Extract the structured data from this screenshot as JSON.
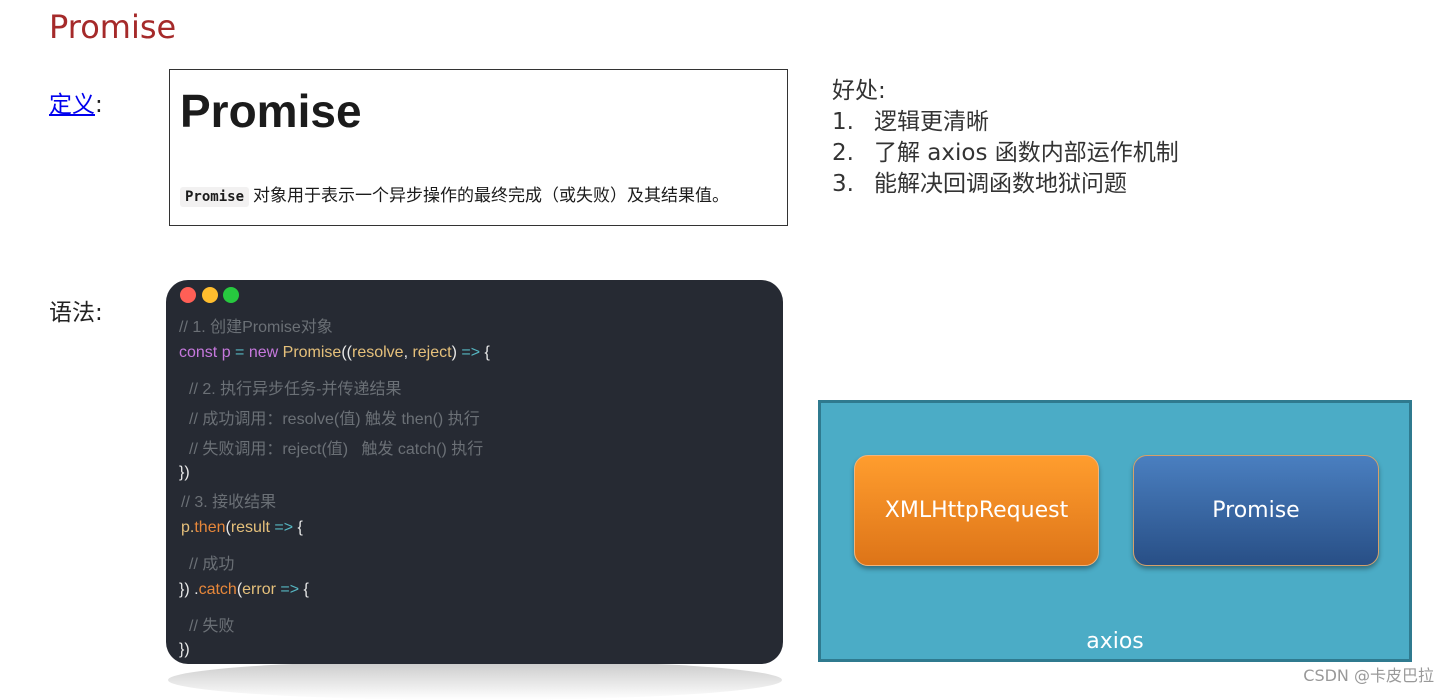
{
  "page_title": "Promise",
  "definition": {
    "link_text": "定义",
    "colon": ":",
    "mdn_title": "Promise",
    "mdn_code": "Promise",
    "mdn_desc": "对象用于表示一个异步操作的最终完成（或失败）及其结果值。"
  },
  "benefits": {
    "heading": "好处:",
    "items": [
      {
        "num": "1.",
        "text": "逻辑更清晰"
      },
      {
        "num": "2.",
        "text": "了解 axios 函数内部运作机制"
      },
      {
        "num": "3.",
        "text": "能解决回调函数地狱问题"
      }
    ]
  },
  "syntax": {
    "label": "语法:",
    "code": {
      "c1": "// 1. 创建Promise对象",
      "l2_const": "const",
      "l2_p": " p ",
      "l2_eq": "=",
      "l2_new": " new ",
      "l2_promise": "Promise",
      "l2_open": "((",
      "l2_resolve": "resolve",
      "l2_comma": ", ",
      "l2_reject": "reject",
      "l2_close": ") ",
      "l2_arrow": "=>",
      "l2_brace": " {",
      "c3": "// 2. 执行异步任务-并传递结果",
      "c4": "// 成功调用：resolve(值) 触发 then() 执行",
      "c5": "// 失败调用：reject(值)   触发 catch() 执行",
      "l6": "})",
      "c7": "// 3. 接收结果",
      "l8_p": "p.",
      "l8_then": "then",
      "l8_open": "(",
      "l8_result": "result",
      "l8_arrow": " =>",
      "l8_brace": " {",
      "c9": "// 成功",
      "l10_close": "}) .",
      "l10_catch": "catch",
      "l10_open": "(",
      "l10_error": "error",
      "l10_arrow": " =>",
      "l10_brace": " {",
      "c11": "// 失败",
      "l12": "})"
    }
  },
  "diagram": {
    "box1": "XMLHttpRequest",
    "box2": "Promise",
    "container": "axios"
  },
  "watermark": "CSDN @卡皮巴拉"
}
